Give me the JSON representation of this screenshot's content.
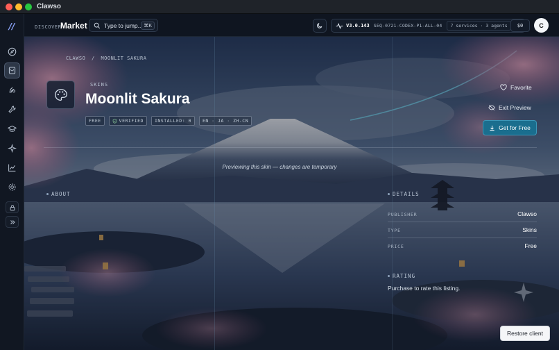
{
  "window": {
    "title": "Clawso"
  },
  "header": {
    "discover_label": "DISCOVER",
    "section_title": "Market",
    "search_placeholder": "Type to jump...",
    "search_shortcut": "⌘K",
    "version": "V3.0.143",
    "sequence": "SEQ-0721-CODEX-P1-ALL-04",
    "services": "7 services · 3 agents",
    "credits": "$0",
    "avatar_initial": "C"
  },
  "sidebar": {
    "items": [
      {
        "name": "compass-icon"
      },
      {
        "name": "store-icon",
        "active": true
      },
      {
        "name": "agents-icon"
      },
      {
        "name": "wrench-icon"
      },
      {
        "name": "graduation-cap-icon"
      },
      {
        "name": "sparkles-icon"
      },
      {
        "name": "chart-icon"
      },
      {
        "name": "gear-icon"
      }
    ],
    "lock": "lock-icon",
    "expand": "double-chevron-right-icon"
  },
  "breadcrumb": {
    "root": "CLAWSO",
    "separator": "/",
    "current": "MOONLIT SAKURA"
  },
  "listing": {
    "kicker": "SKINS",
    "title": "Moonlit Sakura",
    "badges": {
      "free": "FREE",
      "verified": "VERIFIED",
      "installed": "INSTALLED: 0",
      "languages": "EN · JA · ZH-CN"
    }
  },
  "actions": {
    "favorite": "Favorite",
    "exit_preview": "Exit Preview",
    "get": "Get for Free"
  },
  "preview_note": "Previewing this skin — changes are temporary",
  "about": {
    "label": "ABOUT"
  },
  "details": {
    "label": "DETAILS",
    "rows": [
      {
        "key": "PUBLISHER",
        "value": "Clawso"
      },
      {
        "key": "TYPE",
        "value": "Skins"
      },
      {
        "key": "PRICE",
        "value": "Free"
      }
    ]
  },
  "rating": {
    "label": "RATING",
    "text": "Purchase to rate this listing."
  },
  "restore_button": "Restore client",
  "colors": {
    "accent": "#1a6e8e",
    "accent_border": "#3c97b8",
    "sidebar_bg": "#111722",
    "header_bg": "#0f1520"
  }
}
